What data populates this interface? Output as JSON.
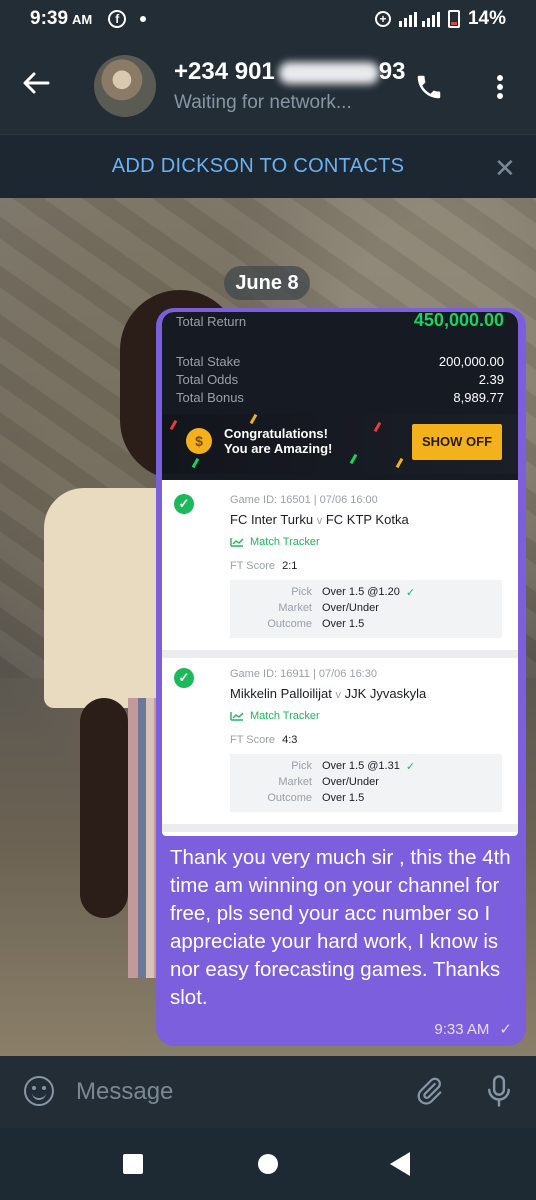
{
  "status_bar": {
    "time": "9:39",
    "ampm": "AM",
    "battery": "14%"
  },
  "header": {
    "contact_name": "+234 901",
    "contact_name_tail": "93",
    "status": "Waiting for network..."
  },
  "add_contact": {
    "label": "ADD DICKSON TO CONTACTS"
  },
  "chat": {
    "date": "June 8",
    "ticket": {
      "total_return_label": "Total Return",
      "total_return_value": "450,000.00",
      "rows": [
        {
          "label": "Total Stake",
          "value": "200,000.00"
        },
        {
          "label": "Total Odds",
          "value": "2.39"
        },
        {
          "label": "Total Bonus",
          "value": "8,989.77"
        }
      ],
      "congrats_line1": "Congratulations!",
      "congrats_line2": "You are Amazing!",
      "show_off_label": "SHOW OFF",
      "games": [
        {
          "game_id": "Game ID: 16501 | 07/06 16:00",
          "home": "FC Inter Turku",
          "vs": "v",
          "away": "FC KTP Kotka",
          "tracker": "Match Tracker",
          "ft_label": "FT Score",
          "ft_value": "2:1",
          "pick_label": "Pick",
          "pick_value": "Over 1.5 @1.20",
          "market_label": "Market",
          "market_value": "Over/Under",
          "outcome_label": "Outcome",
          "outcome_value": "Over 1.5"
        },
        {
          "game_id": "Game ID: 16911 | 07/06 16:30",
          "home": "Mikkelin Palloilijat",
          "vs": "v",
          "away": "JJK Jyvaskyla",
          "tracker": "Match Tracker",
          "ft_label": "FT Score",
          "ft_value": "4:3",
          "pick_label": "Pick",
          "pick_value": "Over 1.5 @1.31",
          "market_label": "Market",
          "market_value": "Over/Under",
          "outcome_label": "Outcome",
          "outcome_value": "Over 1.5"
        }
      ]
    },
    "message": "Thank you very much sir , this the 4th time am winning on your channel for free, pls send your acc number so I appreciate your hard work, I know is nor easy forecasting games. Thanks slot.",
    "message_time": "9:33 AM"
  },
  "input": {
    "placeholder": "Message"
  },
  "colors": {
    "header_bg": "#232d36",
    "link": "#6ab3f3",
    "bubble": "#7b5fdd",
    "win_green": "#19d35e",
    "show_off": "#f3b21c"
  },
  "icons": [
    "back-arrow-icon",
    "phone-icon",
    "more-vert-icon",
    "close-icon",
    "emoji-icon",
    "attach-icon",
    "mic-icon",
    "check-icon",
    "chart-icon",
    "coin-icon"
  ]
}
